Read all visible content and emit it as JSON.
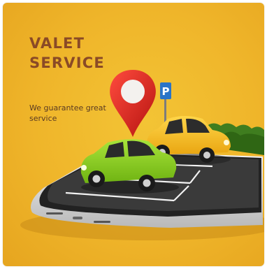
{
  "banner": {
    "headline": "VALET SERVICE",
    "tagline": "We guarantee great service",
    "parking_sign_letter": "P"
  },
  "colors": {
    "background": "#efb52a",
    "headline": "#8a4a26",
    "pin": "#e2231a",
    "green_car": "#8fd31f",
    "yellow_car": "#f6c11a"
  },
  "icons": [
    "map-pin-icon",
    "parking-sign-icon",
    "green-car-illustration",
    "yellow-car-illustration",
    "smartphone-illustration",
    "hedge-illustration"
  ]
}
